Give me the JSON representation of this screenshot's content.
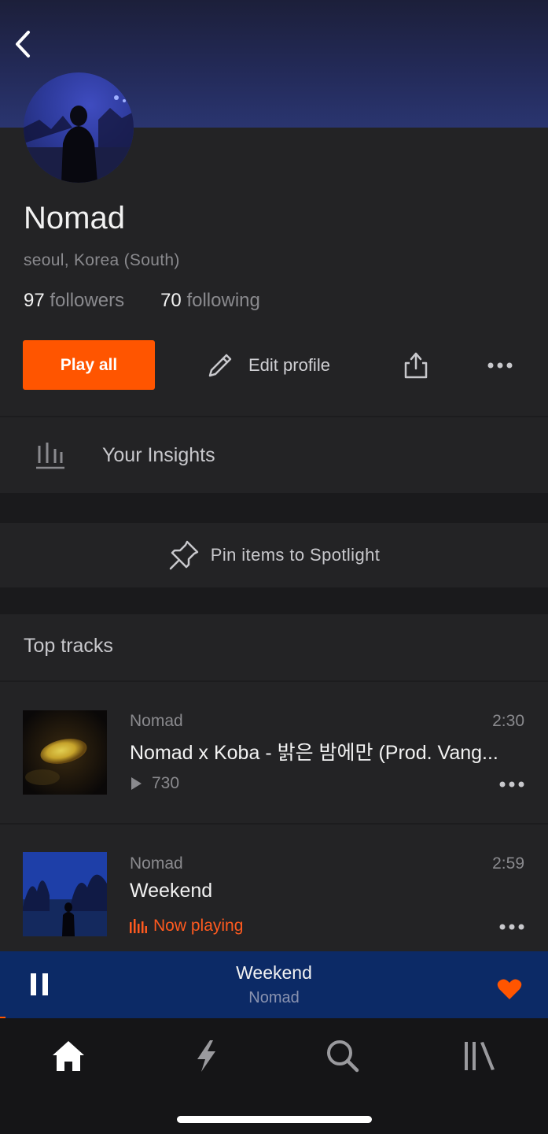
{
  "profile": {
    "name": "Nomad",
    "location": "seoul, Korea (South)",
    "followers_count": "97",
    "followers_label": "followers",
    "following_count": "70",
    "following_label": "following"
  },
  "actions": {
    "play_all": "Play all",
    "edit_profile": "Edit profile"
  },
  "insights": {
    "label": "Your Insights"
  },
  "spotlight": {
    "label": "Pin items to Spotlight"
  },
  "top_tracks": {
    "title": "Top tracks",
    "items": [
      {
        "artist": "Nomad",
        "duration": "2:30",
        "title": "Nomad x Koba - 밝은 밤에만 (Prod. Vang...",
        "plays": "730",
        "status": ""
      },
      {
        "artist": "Nomad",
        "duration": "2:59",
        "title": "Weekend",
        "plays": "",
        "status": "Now playing"
      }
    ]
  },
  "player": {
    "title": "Weekend",
    "artist": "Nomad",
    "progress": 0.01
  },
  "colors": {
    "accent": "#ff5500",
    "player_bg": "#0c2a66",
    "background": "#232325"
  },
  "tabs": [
    {
      "icon": "home-icon",
      "active": true
    },
    {
      "icon": "lightning-icon",
      "active": false
    },
    {
      "icon": "search-icon",
      "active": false
    },
    {
      "icon": "library-icon",
      "active": false
    }
  ]
}
